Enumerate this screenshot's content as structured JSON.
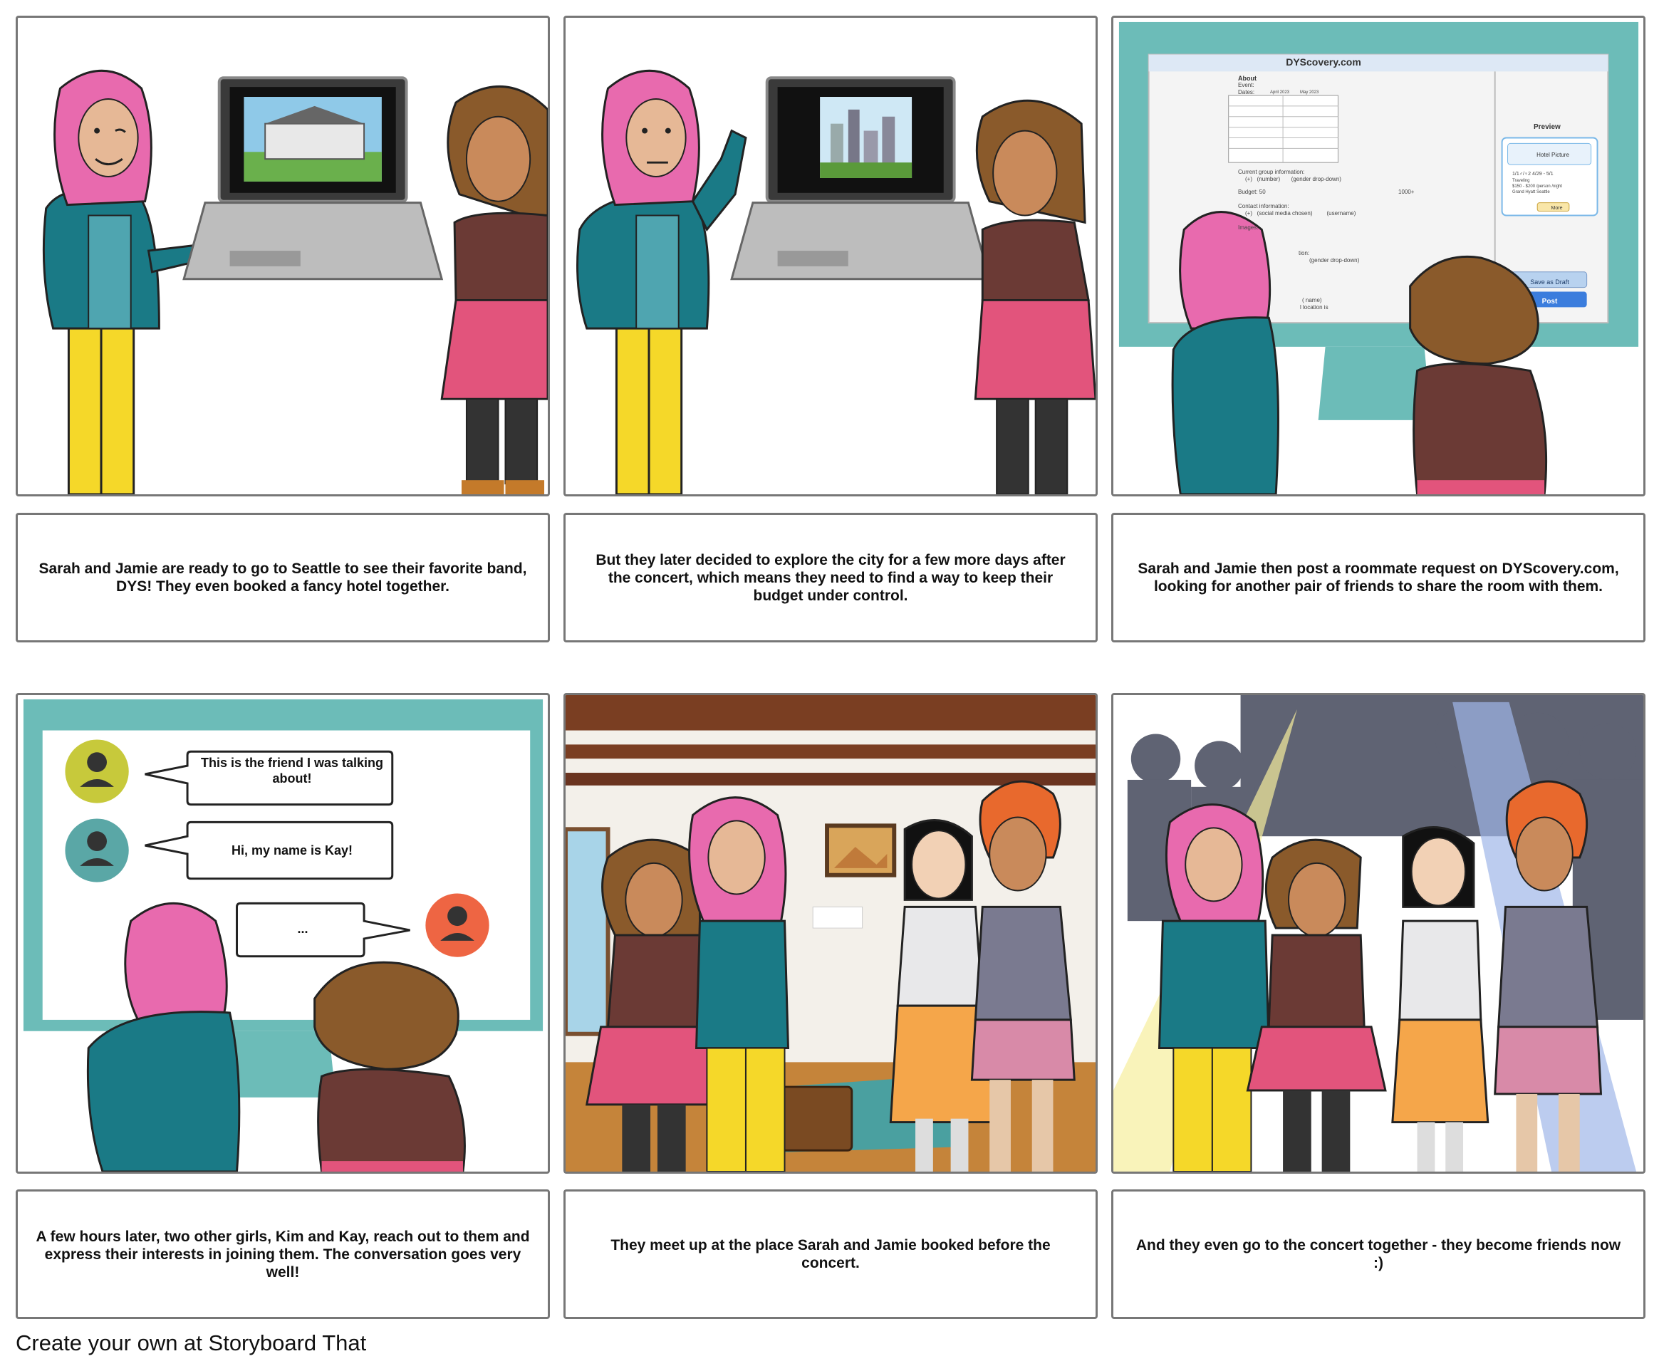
{
  "panels": [
    {
      "caption": "Sarah and Jamie are ready to go to Seattle to see their favorite band, DYS! They even booked a fancy hotel together."
    },
    {
      "caption": "But they later decided to explore the city for a few more days after the concert, which means they need to find a way to keep their budget under control."
    },
    {
      "caption": "Sarah and Jamie then post a roommate request on DYScovery.com, looking for another pair of friends to share the room with them."
    },
    {
      "caption": "A few hours later, two other girls, Kim and Kay, reach out to them and express their interests in joining them. The conversation goes very well!"
    },
    {
      "caption": "They meet up at the place Sarah and Jamie booked before the concert."
    },
    {
      "caption": "And they even go to the concert together - they become friends now :)"
    }
  ],
  "website": {
    "title": "DYScovery.com",
    "about": "About",
    "event": "Event:",
    "dates": "Dates:",
    "month1": "April 2023",
    "month2": "May 2023",
    "group_info": "Current group information:",
    "group_fields": "(+)   (number)       (gender drop-down)",
    "budget": "Budget: 50",
    "budget_max": "1000+",
    "contact": "Contact information:",
    "contact_fields": "(+)   (social media chosen)         (username)",
    "images": "Images:",
    "images_btn": "+",
    "info_partial": "tion:",
    "gender_partial": "(gender drop-down)",
    "name_partial": "( name)",
    "location_partial": "l location is",
    "preview_title": "Preview",
    "preview_hotel": "Hotel Picture",
    "preview_line1": "1/1♂/♀2     4/29 - 5/1",
    "preview_line2": "Traveling",
    "preview_line3": "$150 - $200 /person /night",
    "preview_line4": "Grand Hyatt Seattle",
    "preview_more": "More",
    "save_draft": "Save as Draft",
    "post": "Post"
  },
  "chat": {
    "msg1": "This is the friend I was talking about!",
    "msg2": "Hi, my name is Kay!",
    "msg3": "..."
  },
  "footer": "Create your own at Storyboard That",
  "colors": {
    "hijab": "#e86aae",
    "jacket_teal": "#1a7a86",
    "pants_yellow": "#f5d829",
    "skirt_pink": "#e2547c",
    "jacket_brown": "#6b3a35",
    "hair_brown": "#8a5a2b",
    "monitor_teal": "#6cbcb8",
    "hair_orange": "#e8692d"
  }
}
